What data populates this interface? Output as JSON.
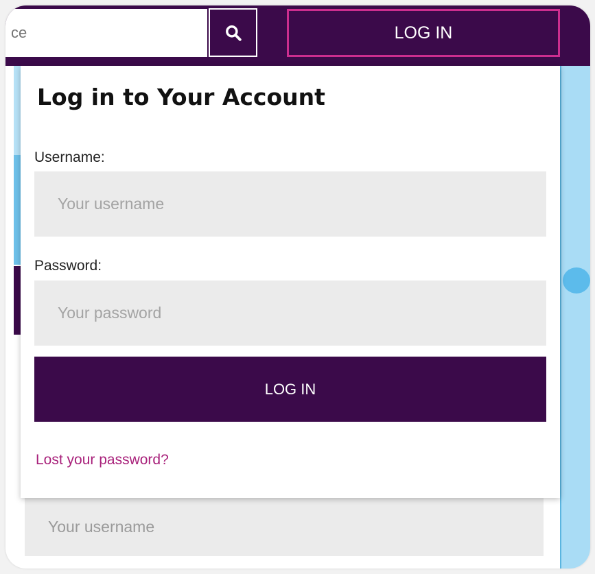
{
  "header": {
    "search": {
      "placeholder": "ce"
    },
    "search_icon": "search-icon",
    "login_label": "LOG IN"
  },
  "login_form": {
    "title": "Log in to Your Account",
    "username_label": "Username:",
    "username_placeholder": "Your username",
    "password_label": "Password:",
    "password_placeholder": "Your password",
    "submit_label": "LOG IN",
    "lost_password_label": "Lost your password?"
  },
  "background_form": {
    "username_placeholder": "Your username"
  },
  "colors": {
    "brand_purple": "#3b0a4a",
    "accent_pink": "#cc2e8f",
    "link_magenta": "#a8207a",
    "light_blue": "#a9dcf5",
    "field_gray": "#ebebeb"
  }
}
